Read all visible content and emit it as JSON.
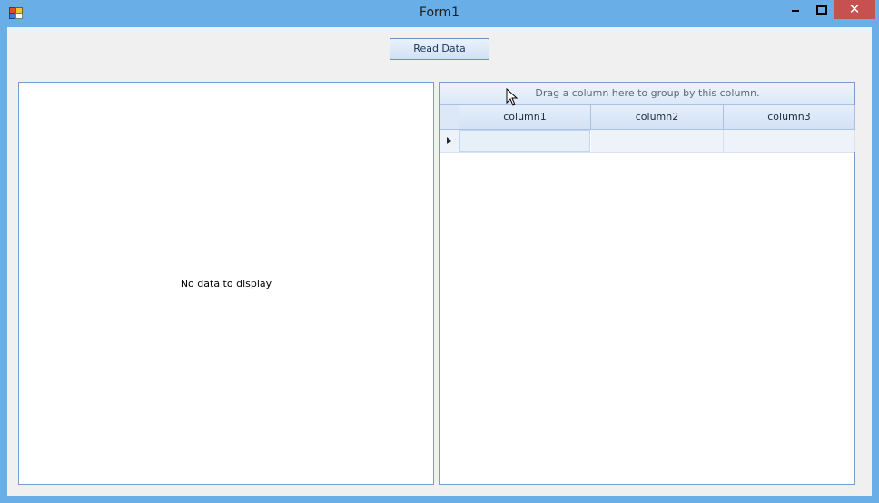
{
  "window": {
    "title": "Form1",
    "close_glyph": "✕"
  },
  "toolbar": {
    "read_data_label": "Read Data"
  },
  "left_panel": {
    "empty_text": "No data to display"
  },
  "grid": {
    "group_hint": "Drag a column here to group by this column.",
    "columns": [
      "column1",
      "column2",
      "column3"
    ],
    "rows": [
      [
        "",
        "",
        ""
      ]
    ]
  },
  "colors": {
    "titlebar": "#6aaee8",
    "close": "#c75050",
    "client_bg": "#f0f0f0",
    "border": "#7a9cc9"
  },
  "icons": [
    "app-icon",
    "minimize-icon",
    "maximize-icon",
    "close-icon",
    "row-indicator-arrow-icon",
    "mouse-cursor-icon"
  ]
}
